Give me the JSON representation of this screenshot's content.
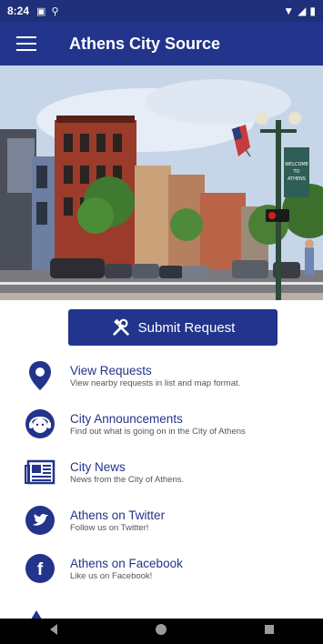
{
  "status": {
    "time": "8:24"
  },
  "appbar": {
    "title": "Athens City Source"
  },
  "submit": {
    "label": "Submit Request"
  },
  "items": [
    {
      "title": "View Requests",
      "subtitle": "View nearby requests in list and map format."
    },
    {
      "title": "City Announcements",
      "subtitle": "Find out what is going on in the City of Athens"
    },
    {
      "title": "City News",
      "subtitle": "News from the City of Athens."
    },
    {
      "title": "Athens on Twitter",
      "subtitle": "Follow us on Twitter!"
    },
    {
      "title": "Athens on Facebook",
      "subtitle": "Like us on Facebook!"
    }
  ],
  "colors": {
    "primary": "#22348b",
    "status": "#1f2f7a"
  },
  "hero": {
    "sign_text": "WELCOME TO ATHENS"
  }
}
